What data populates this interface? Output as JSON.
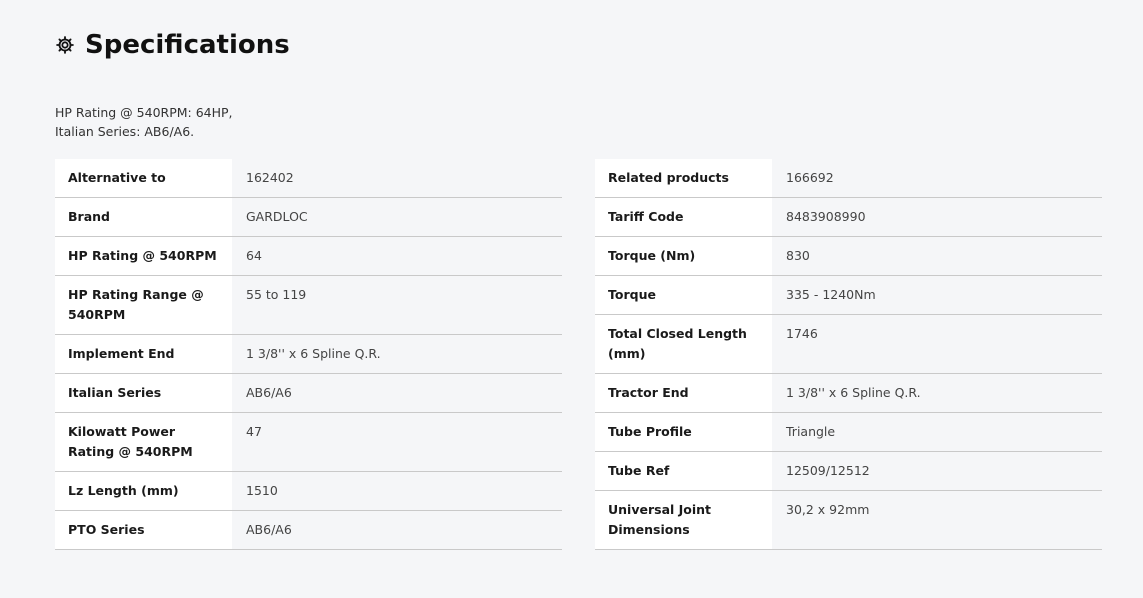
{
  "page": {
    "title": "Specifications",
    "icon": "gear-icon"
  },
  "intro": [
    "HP Rating @ 540RPM: 64HP,",
    "Italian Series: AB6/A6."
  ],
  "specs_left": [
    {
      "label": "Alternative to",
      "value": "162402"
    },
    {
      "label": "Brand",
      "value": "GARDLOC"
    },
    {
      "label": "HP Rating @ 540RPM",
      "value": "64"
    },
    {
      "label": "HP Rating Range @ 540RPM",
      "value": "55 to 119"
    },
    {
      "label": "Implement End",
      "value": "1 3/8'' x 6 Spline Q.R."
    },
    {
      "label": "Italian Series",
      "value": "AB6/A6"
    },
    {
      "label": "Kilowatt Power Rating @ 540RPM",
      "value": "47"
    },
    {
      "label": "Lz Length (mm)",
      "value": "1510"
    },
    {
      "label": "PTO Series",
      "value": "AB6/A6"
    }
  ],
  "specs_right": [
    {
      "label": "Related products",
      "value": "166692"
    },
    {
      "label": "Tariff Code",
      "value": "8483908990"
    },
    {
      "label": "Torque (Nm)",
      "value": "830"
    },
    {
      "label": "Torque",
      "value": "335 - 1240Nm"
    },
    {
      "label": "Total Closed Length (mm)",
      "value": "1746"
    },
    {
      "label": "Tractor End",
      "value": "1 3/8'' x 6 Spline Q.R."
    },
    {
      "label": "Tube Profile",
      "value": "Triangle"
    },
    {
      "label": "Tube Ref",
      "value": "12509/12512"
    },
    {
      "label": "Universal Joint Dimensions",
      "value": "30,2 x 92mm"
    }
  ]
}
